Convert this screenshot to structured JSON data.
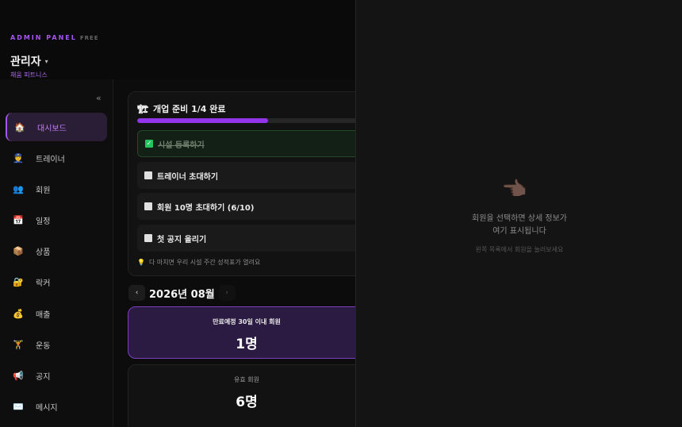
{
  "header": {
    "brand": "ADMIN PANEL",
    "plan": "FREE",
    "user_name": "관리자",
    "caret": "▾",
    "gym_name": "채움 피트니스"
  },
  "sidebar": {
    "collapse": "«",
    "items": [
      {
        "icon": "🏠",
        "icon_name": "home-icon",
        "label": "대시보드",
        "active": true
      },
      {
        "icon": "👮",
        "icon_name": "trainer-icon",
        "label": "트레이너"
      },
      {
        "icon": "👥",
        "icon_name": "members-icon",
        "label": "회원"
      },
      {
        "icon": "📅",
        "icon_name": "calendar-icon",
        "label": "일정"
      },
      {
        "icon": "📦",
        "icon_name": "package-icon",
        "label": "상품"
      },
      {
        "icon": "🔐",
        "icon_name": "lock-icon",
        "label": "락커"
      },
      {
        "icon": "💰",
        "icon_name": "money-bag-icon",
        "label": "매출"
      },
      {
        "icon": "🏋",
        "icon_name": "weightlifting-icon",
        "label": "운동"
      },
      {
        "icon": "📢",
        "icon_name": "megaphone-icon",
        "label": "공지"
      },
      {
        "icon": "✉️",
        "icon_name": "envelope-icon",
        "label": "메시지"
      }
    ]
  },
  "onboarding": {
    "icon": "🏗",
    "title": "개업 준비 1/4 완료",
    "progress": 0.57,
    "tasks": [
      {
        "label": "시설 등록하기",
        "done": true,
        "check": "✓"
      },
      {
        "label": "트레이너 초대하기",
        "done": false
      },
      {
        "label": "회원 10명 초대하기 (6/10)",
        "done": false
      },
      {
        "label": "첫 공지 올리기",
        "done": false
      }
    ],
    "hint_icon": "💡",
    "hint": "다 마치면 우리 시설 주간 성적표가 열려요"
  },
  "month": {
    "prev": "‹",
    "label": "2026년 08월",
    "next": "›"
  },
  "stats": [
    {
      "label": "만료예정 30일 이내 회원",
      "value": "1명"
    },
    {
      "label": "유효 회원",
      "value": "6명"
    }
  ],
  "detail": {
    "pointer": "👈🏿",
    "title_line1": "회원을 선택하면 상세 정보가",
    "title_line2": "여기 표시됩니다",
    "subtitle": "왼쪽 목록에서 회원을 눌러보세요"
  },
  "colors": {
    "accent": "#a855f7",
    "progress": "#9333ea",
    "done": "#22c55e"
  }
}
